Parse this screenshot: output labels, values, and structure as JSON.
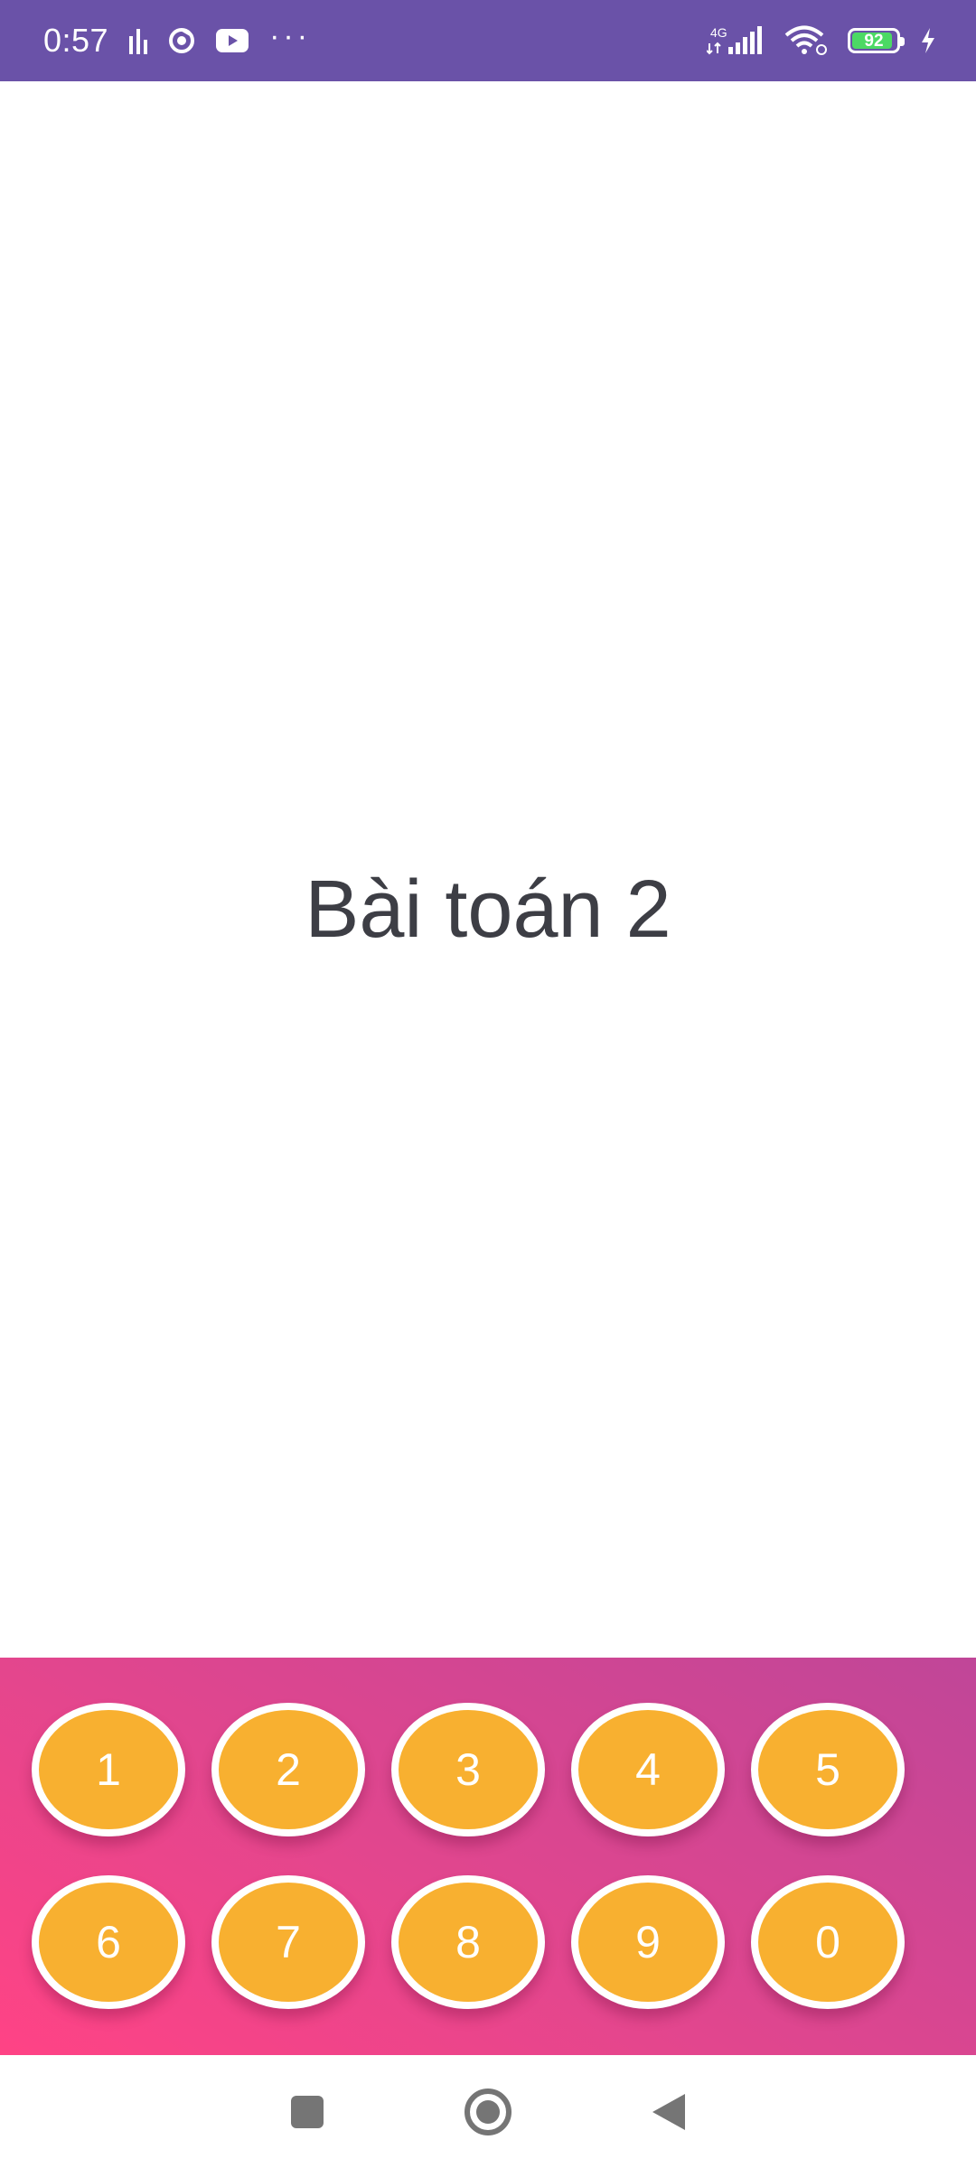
{
  "status_bar": {
    "time": "0:57",
    "network": "4G",
    "battery_level": "92",
    "battery_fraction": 0.92,
    "dots": "···",
    "icons": [
      "signal-activity-icon",
      "chrome-icon",
      "youtube-icon",
      "more-dots-icon",
      "cellular-signal-icon",
      "wifi-icon",
      "battery-icon",
      "charging-icon"
    ]
  },
  "main": {
    "title": "Bài toán 2"
  },
  "keypad": {
    "keys": [
      "1",
      "2",
      "3",
      "4",
      "5",
      "6",
      "7",
      "8",
      "9",
      "0"
    ]
  },
  "nav_bar": {
    "icons": [
      "recents-square-icon",
      "home-circle-icon",
      "back-triangle-icon"
    ]
  },
  "colors": {
    "status_bar": "#6a52a8",
    "key_fill": "#f8b030",
    "keypad_gradient_start": "#ff4385",
    "keypad_gradient_end": "#c04698",
    "title_text": "#3d3e45",
    "battery_fill": "#4cd964"
  }
}
